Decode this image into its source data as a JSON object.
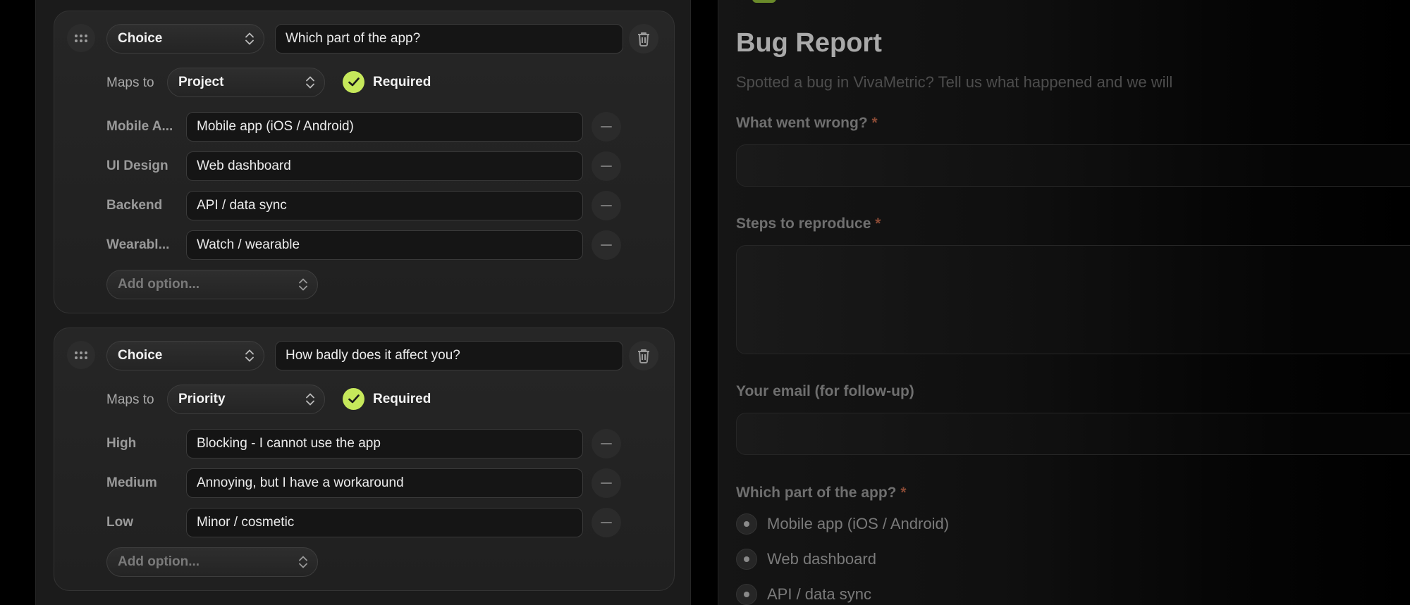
{
  "editor": {
    "questions": [
      {
        "type": "Choice",
        "question": "Which part of the app?",
        "maps_label": "Maps to",
        "maps_to": "Project",
        "required_label": "Required",
        "options": [
          {
            "key": "Mobile A...",
            "label": "Mobile app (iOS / Android)"
          },
          {
            "key": "UI Design",
            "label": "Web dashboard"
          },
          {
            "key": "Backend",
            "label": "API / data sync"
          },
          {
            "key": "Wearabl...",
            "label": "Watch / wearable"
          }
        ],
        "add_option_placeholder": "Add option..."
      },
      {
        "type": "Choice",
        "question": "How badly does it affect you?",
        "maps_label": "Maps to",
        "maps_to": "Priority",
        "required_label": "Required",
        "options": [
          {
            "key": "High",
            "label": "Blocking - I cannot use the app"
          },
          {
            "key": "Medium",
            "label": "Annoying, but I have a workaround"
          },
          {
            "key": "Low",
            "label": "Minor / cosmetic"
          }
        ],
        "add_option_placeholder": "Add option..."
      }
    ]
  },
  "preview": {
    "title": "Bug Report",
    "subtitle": "Spotted a bug in VivaMetric? Tell us what happened and we will",
    "fields": [
      {
        "label": "What went wrong?",
        "required": "*"
      },
      {
        "label": "Steps to reproduce",
        "required": "*"
      },
      {
        "label": "Your email (for follow-up)",
        "required": ""
      },
      {
        "label": "Which part of the app?",
        "required": "*"
      }
    ],
    "choices": [
      "Mobile app (iOS / Android)",
      "Web dashboard",
      "API / data sync"
    ]
  },
  "colors": {
    "accent": "#c6e85b",
    "required_star": "#8a4a35"
  },
  "icons": {
    "drag": "drag-handle-icon",
    "delete": "trash-icon",
    "remove": "minus-icon",
    "check": "check-icon",
    "select": "chevron-up-down-icon"
  }
}
